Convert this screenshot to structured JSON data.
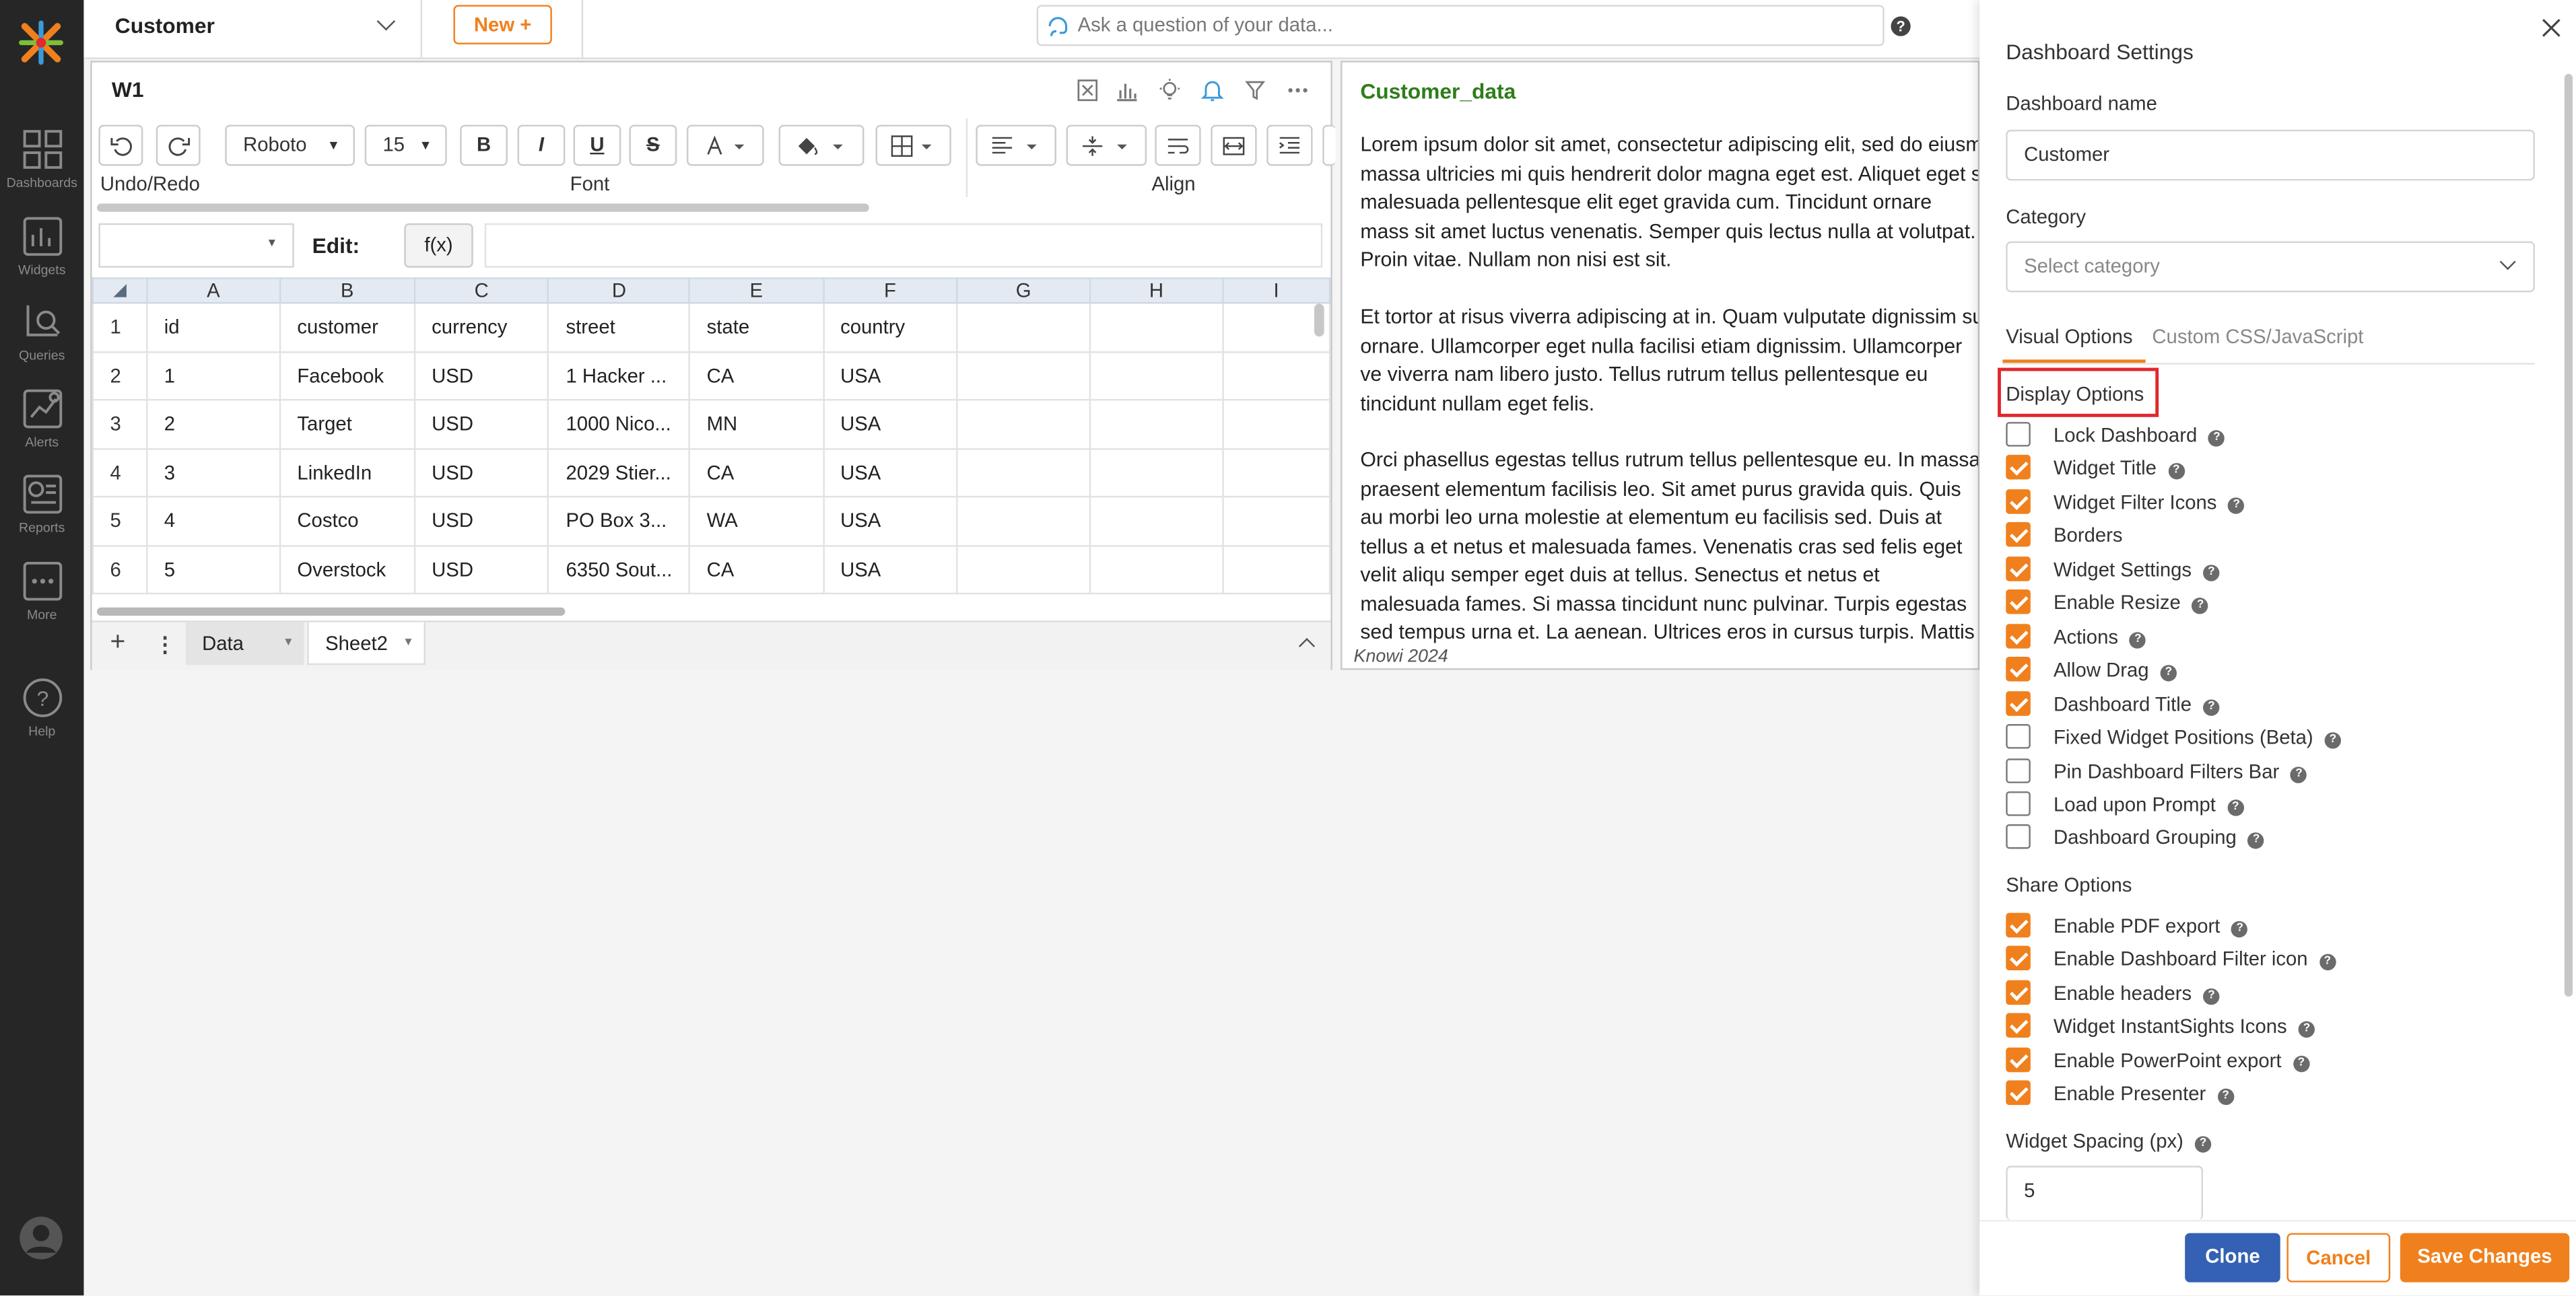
{
  "nav": {
    "items": [
      {
        "label": "Dashboards",
        "icon": "dashboards-icon"
      },
      {
        "label": "Widgets",
        "icon": "widgets-icon"
      },
      {
        "label": "Queries",
        "icon": "queries-icon"
      },
      {
        "label": "Alerts",
        "icon": "alerts-icon"
      },
      {
        "label": "Reports",
        "icon": "reports-icon"
      },
      {
        "label": "More",
        "icon": "more-icon"
      },
      {
        "label": "Help",
        "icon": "help-icon"
      }
    ]
  },
  "topbar": {
    "dashboard_selected": "Customer",
    "new_button": "New +",
    "ask_placeholder": "Ask a question of your data..."
  },
  "widget1": {
    "title": "W1",
    "ribbon": {
      "font_family": "Roboto",
      "font_size": "15",
      "bold": "B",
      "italic": "I",
      "underline": "U",
      "strike": "S",
      "groups": {
        "undo": "Undo/Redo",
        "font": "Font",
        "align": "Align"
      }
    },
    "formula": {
      "edit_label": "Edit:",
      "fx_label": "f(x)"
    },
    "sheet": {
      "columns": [
        "A",
        "B",
        "C",
        "D",
        "E",
        "F",
        "G",
        "H",
        "I"
      ],
      "rows": [
        {
          "n": "1",
          "cells": [
            "id",
            "customer",
            "currency",
            "street",
            "state",
            "country",
            "",
            "",
            ""
          ]
        },
        {
          "n": "2",
          "cells": [
            "1",
            "Facebook",
            "USD",
            "1 Hacker ...",
            "CA",
            "USA",
            "",
            "",
            ""
          ]
        },
        {
          "n": "3",
          "cells": [
            "2",
            "Target",
            "USD",
            "1000 Nico...",
            "MN",
            "USA",
            "",
            "",
            ""
          ]
        },
        {
          "n": "4",
          "cells": [
            "3",
            "LinkedIn",
            "USD",
            "2029 Stier...",
            "CA",
            "USA",
            "",
            "",
            ""
          ]
        },
        {
          "n": "5",
          "cells": [
            "4",
            "Costco",
            "USD",
            "PO Box 3...",
            "WA",
            "USA",
            "",
            "",
            ""
          ]
        },
        {
          "n": "6",
          "cells": [
            "5",
            "Overstock",
            "USD",
            "6350 Sout...",
            "CA",
            "USA",
            "",
            "",
            ""
          ]
        }
      ]
    },
    "tabs": [
      "Data",
      "Sheet2"
    ]
  },
  "textwidget": {
    "title": "Customer_data",
    "paragraphs": [
      "Lorem ipsum dolor sit amet, consectetur adipiscing elit, sed do eiusm massa ultricies mi quis hendrerit dolor magna eget est. Aliquet eget s malesuada pellentesque elit eget gravida cum. Tincidunt ornare mass sit amet luctus venenatis. Semper quis lectus nulla at volutpat. Proin vitae. Nullam non nisi est sit.",
      "Et tortor at risus viverra adipiscing at in. Quam vulputate dignissim su ornare. Ullamcorper eget nulla facilisi etiam dignissim. Ullamcorper ve viverra nam libero justo. Tellus rutrum tellus pellentesque eu tincidunt nullam eget felis.",
      "Orci phasellus egestas tellus rutrum tellus pellentesque eu. In massa praesent elementum facilisis leo. Sit amet purus gravida quis. Quis au morbi leo urna molestie at elementum eu facilisis sed. Duis at tellus a et netus et malesuada fames. Venenatis cras sed felis eget velit aliqu semper eget duis at tellus. Senectus et netus et malesuada fames. Si massa tincidunt nunc pulvinar. Turpis egestas sed tempus urna et. La aenean. Ultrices eros in cursus turpis. Mattis rhoncus urna neque vive"
    ],
    "footer": "Knowi 2024"
  },
  "panel": {
    "title": "Dashboard Settings",
    "name_label": "Dashboard name",
    "name_value": "Customer",
    "category_label": "Category",
    "category_placeholder": "Select category",
    "tabs": [
      "Visual Options",
      "Custom CSS/JavaScript"
    ],
    "display_heading": "Display Options",
    "display": [
      {
        "label": "Lock Dashboard",
        "checked": false,
        "help": true
      },
      {
        "label": "Widget Title",
        "checked": true,
        "help": true
      },
      {
        "label": "Widget Filter Icons",
        "checked": true,
        "help": true
      },
      {
        "label": "Borders",
        "checked": true,
        "help": false
      },
      {
        "label": "Widget Settings",
        "checked": true,
        "help": true
      },
      {
        "label": "Enable Resize",
        "checked": true,
        "help": true
      },
      {
        "label": "Actions",
        "checked": true,
        "help": true
      },
      {
        "label": "Allow Drag",
        "checked": true,
        "help": true
      },
      {
        "label": "Dashboard Title",
        "checked": true,
        "help": true
      },
      {
        "label": "Fixed Widget Positions (Beta)",
        "checked": false,
        "help": true
      },
      {
        "label": "Pin Dashboard Filters Bar",
        "checked": false,
        "help": true
      },
      {
        "label": "Load upon Prompt",
        "checked": false,
        "help": true
      },
      {
        "label": "Dashboard Grouping",
        "checked": false,
        "help": true
      }
    ],
    "share_heading": "Share Options",
    "share": [
      {
        "label": "Enable PDF export",
        "checked": true,
        "help": true
      },
      {
        "label": "Enable Dashboard Filter icon",
        "checked": true,
        "help": true
      },
      {
        "label": "Enable headers",
        "checked": true,
        "help": true
      },
      {
        "label": "Widget InstantSights Icons",
        "checked": true,
        "help": true
      },
      {
        "label": "Enable PowerPoint export",
        "checked": true,
        "help": true
      },
      {
        "label": "Enable Presenter",
        "checked": true,
        "help": true
      }
    ],
    "spacing_label": "Widget Spacing (px)",
    "spacing_value": "5",
    "buttons": {
      "clone": "Clone",
      "cancel": "Cancel",
      "save": "Save Changes"
    },
    "colors": {
      "accent": "#f0801d",
      "primary": "#3461b4",
      "highlight": "#e0282e"
    }
  }
}
